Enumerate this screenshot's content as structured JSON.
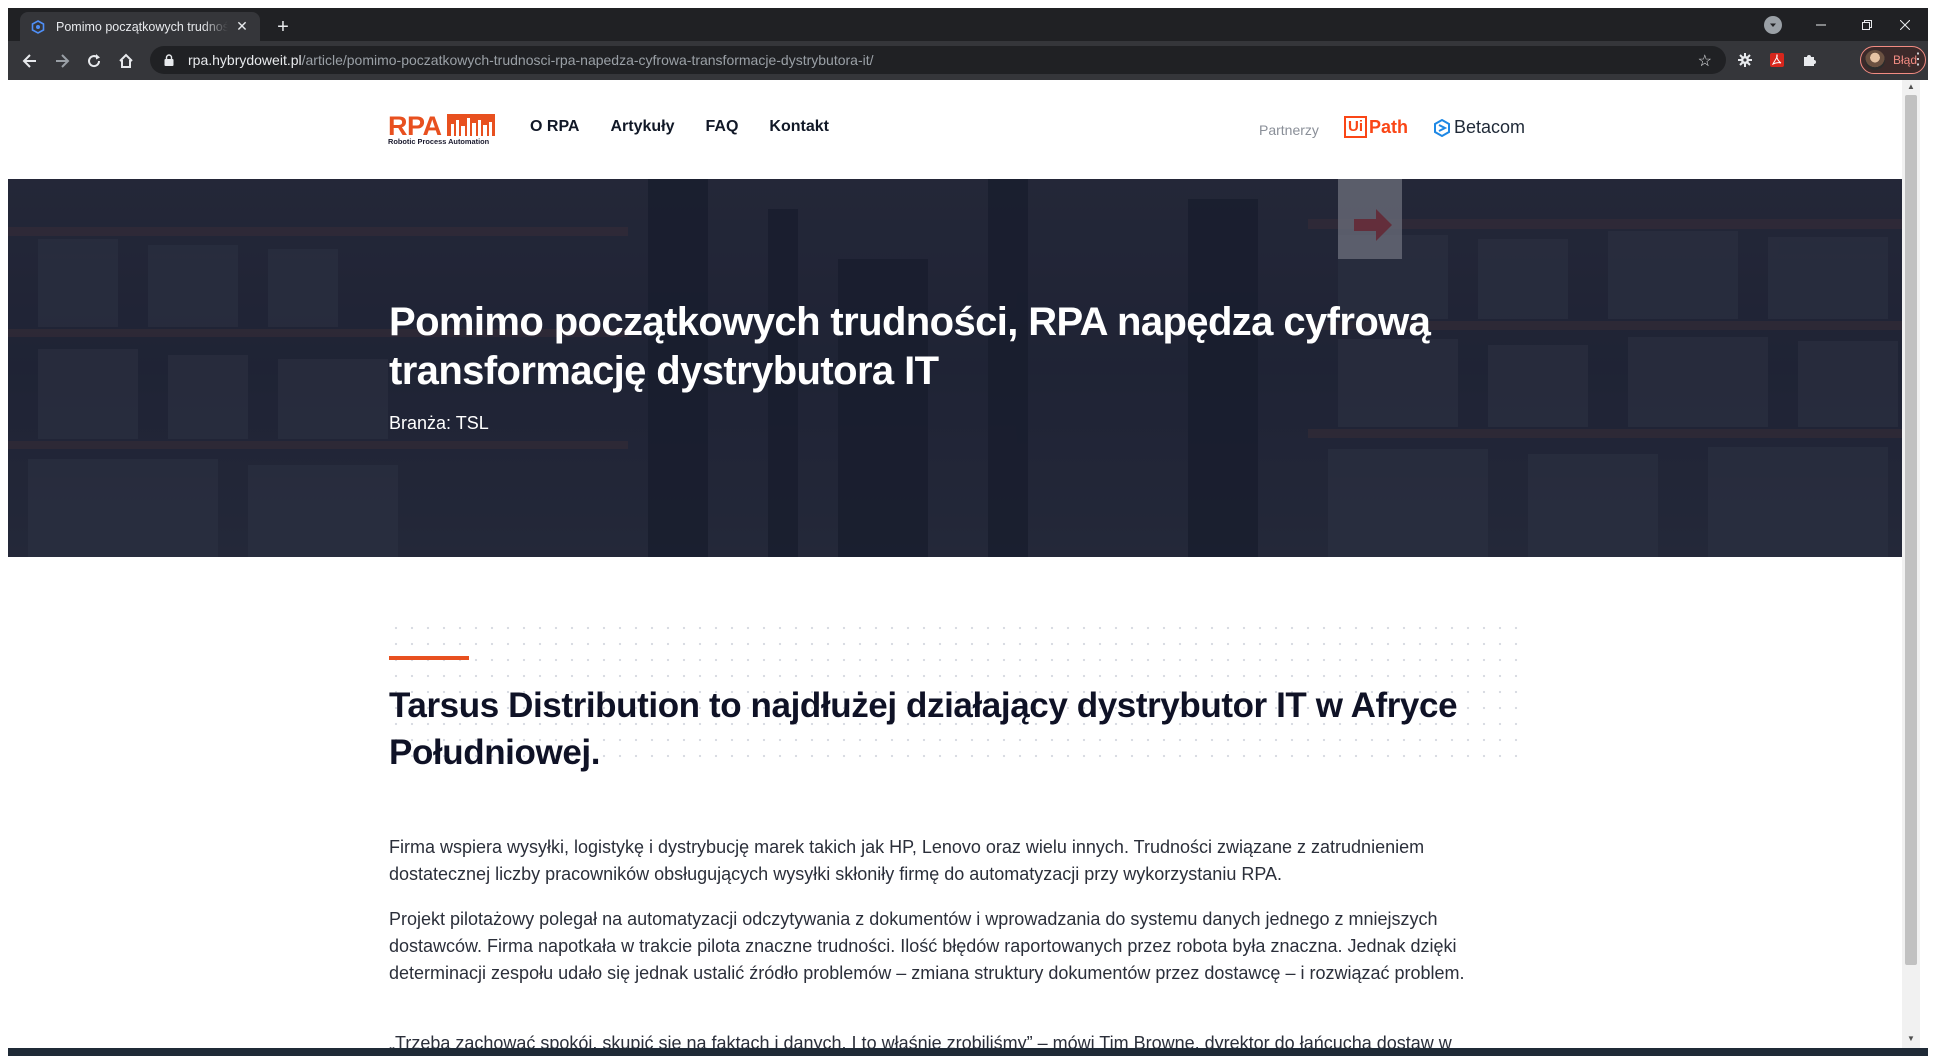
{
  "browser": {
    "tab_title": "Pomimo początkowych trudności, RPA napędza cyfrową transformację dystrybutora IT",
    "tab_close": "✕",
    "new_tab": "+",
    "url_host": "rpa.hybrydoweit.pl",
    "url_path": "/article/pomimo-poczatkowych-trudnosci-rpa-napedza-cyfrowa-transformacje-dystrybutora-it/",
    "profile_label": "Błąd",
    "accent_color": "#f28b82"
  },
  "site": {
    "logo_text": "RPA",
    "logo_subtitle": "Robotic Process Automation",
    "nav": [
      "O RPA",
      "Artykuły",
      "FAQ",
      "Kontakt"
    ],
    "partners_label": "Partnerzy",
    "partner_uipath_box": "Ui",
    "partner_uipath_text": "Path",
    "partner_betacom": "Betacom",
    "brand_color": "#e8501f"
  },
  "hero": {
    "title": "Pomimo początkowych trudności, RPA napędza cyfrową transformację dystrybutora IT",
    "industry": "Branża: TSL"
  },
  "article": {
    "headline": "Tarsus Distribution to najdłużej działający dystrybutor IT w Afryce Południowej.",
    "paragraphs": [
      "Firma wspiera wysyłki, logistykę i dystrybucję marek takich jak HP, Lenovo oraz wielu innych. Trudności związane z zatrudnieniem dostatecznej liczby pracowników obsługujących wysyłki skłoniły firmę do automatyzacji przy wykorzystaniu RPA.",
      "Projekt pilotażowy polegał na automatyzacji odczytywania z dokumentów i wprowadzania do systemu danych jednego z mniejszych dostawców. Firma napotkała w trakcie pilota znaczne trudności. Ilość błędów raportowanych przez robota była znaczna. Jednak dzięki determinacji zespołu udało się jednak ustalić źródło problemów – zmiana struktury dokumentów przez dostawcę – i rozwiązać problem.",
      "„Trzeba zachować spokój, skupić się na faktach i danych. I to właśnie zrobiliśmy” – mówi Tim Browne, dyrektor do łańcucha dostaw w"
    ]
  }
}
